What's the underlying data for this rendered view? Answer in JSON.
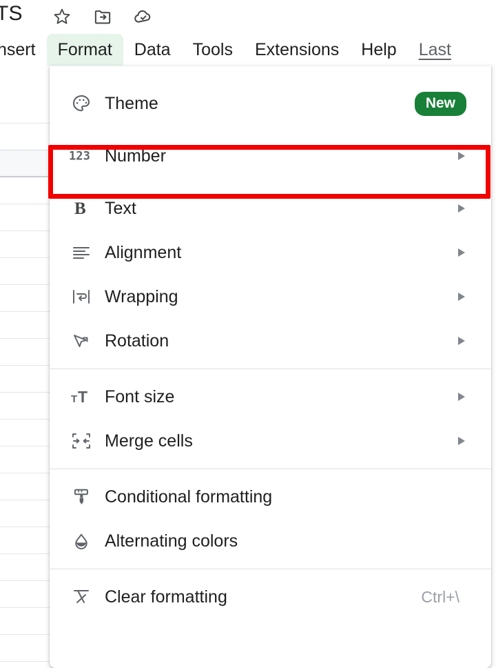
{
  "topbar": {
    "doc_title": "TS",
    "icons": [
      {
        "name": "star-icon",
        "label": "Star"
      },
      {
        "name": "move-folder-icon",
        "label": "Move to folder"
      },
      {
        "name": "cloud-saved-icon",
        "label": "Saved to Drive"
      }
    ]
  },
  "menubar": {
    "items": [
      {
        "label": "nsert",
        "active": false,
        "link": false
      },
      {
        "label": "Format",
        "active": true,
        "link": false
      },
      {
        "label": "Data",
        "active": false,
        "link": false
      },
      {
        "label": "Tools",
        "active": false,
        "link": false
      },
      {
        "label": "Extensions",
        "active": false,
        "link": false
      },
      {
        "label": "Help",
        "active": false,
        "link": false
      },
      {
        "label": "Last",
        "active": false,
        "link": true
      }
    ]
  },
  "format_menu": {
    "items": [
      {
        "label": "Theme",
        "icon": "palette-icon",
        "badge": "New",
        "arrow": false,
        "shortcut": ""
      },
      {
        "label": "Number",
        "icon": "number-123-icon",
        "badge": "",
        "arrow": true,
        "shortcut": ""
      },
      {
        "label": "Text",
        "icon": "bold-b-icon",
        "badge": "",
        "arrow": true,
        "shortcut": ""
      },
      {
        "label": "Alignment",
        "icon": "alignment-icon",
        "badge": "",
        "arrow": true,
        "shortcut": ""
      },
      {
        "label": "Wrapping",
        "icon": "wrapping-icon",
        "badge": "",
        "arrow": true,
        "shortcut": ""
      },
      {
        "label": "Rotation",
        "icon": "rotation-icon",
        "badge": "",
        "arrow": true,
        "shortcut": ""
      },
      {
        "label": "Font size",
        "icon": "font-size-icon",
        "badge": "",
        "arrow": true,
        "shortcut": ""
      },
      {
        "label": "Merge cells",
        "icon": "merge-cells-icon",
        "badge": "",
        "arrow": true,
        "shortcut": ""
      },
      {
        "label": "Conditional formatting",
        "icon": "paint-roller-icon",
        "badge": "",
        "arrow": false,
        "shortcut": ""
      },
      {
        "label": "Alternating colors",
        "icon": "droplet-icon",
        "badge": "",
        "arrow": false,
        "shortcut": ""
      },
      {
        "label": "Clear formatting",
        "icon": "clear-formatting-icon",
        "badge": "",
        "arrow": false,
        "shortcut": "Ctrl+\\"
      }
    ]
  },
  "highlight": {
    "target_label": "Number",
    "color": "#f20000"
  },
  "colors": {
    "accent_green": "#188038",
    "active_tab_bg": "#e6f4ea",
    "text_primary": "#1f1f1f",
    "text_secondary": "#5f6368",
    "text_muted": "#9aa0a6",
    "separator": "#e0e0e0",
    "grid_line": "#e4e6e8"
  }
}
